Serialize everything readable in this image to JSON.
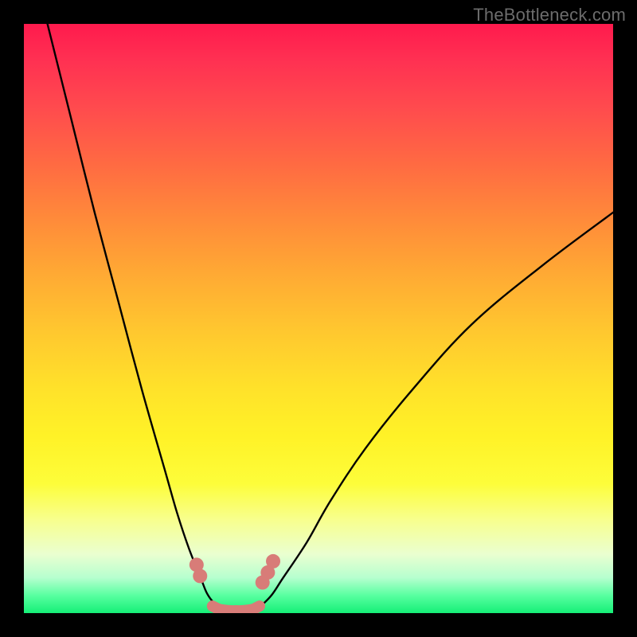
{
  "watermark": "TheBottleneck.com",
  "gradient": {
    "stops": [
      {
        "pos": 0.0,
        "color": "#ff1a4d"
      },
      {
        "pos": 0.06,
        "color": "#ff3052"
      },
      {
        "pos": 0.14,
        "color": "#ff4a4e"
      },
      {
        "pos": 0.24,
        "color": "#ff6b42"
      },
      {
        "pos": 0.33,
        "color": "#ff8a3a"
      },
      {
        "pos": 0.42,
        "color": "#ffa834"
      },
      {
        "pos": 0.52,
        "color": "#ffc72f"
      },
      {
        "pos": 0.62,
        "color": "#ffe22a"
      },
      {
        "pos": 0.7,
        "color": "#fff227"
      },
      {
        "pos": 0.78,
        "color": "#fdfd3a"
      },
      {
        "pos": 0.84,
        "color": "#f8ff8c"
      },
      {
        "pos": 0.9,
        "color": "#eaffd0"
      },
      {
        "pos": 0.94,
        "color": "#b6ffcf"
      },
      {
        "pos": 0.97,
        "color": "#58ffa0"
      },
      {
        "pos": 1.0,
        "color": "#15ef77"
      }
    ]
  },
  "chart_data": {
    "type": "line",
    "title": "",
    "xlabel": "",
    "ylabel": "",
    "xlim": [
      0,
      100
    ],
    "ylim": [
      0,
      100
    ],
    "grid": false,
    "series": [
      {
        "name": "left-branch",
        "x": [
          4,
          8,
          12,
          16,
          20,
          24,
          26,
          28,
          30,
          31,
          32,
          33
        ],
        "y": [
          100,
          84,
          68,
          53,
          38,
          24,
          17,
          11,
          6,
          3.5,
          2,
          1
        ]
      },
      {
        "name": "right-branch",
        "x": [
          40,
          42,
          44,
          48,
          52,
          58,
          66,
          76,
          88,
          100
        ],
        "y": [
          1,
          3,
          6,
          12,
          19,
          28,
          38,
          49,
          59,
          68
        ]
      },
      {
        "name": "valley-floor",
        "x": [
          32,
          33,
          34,
          35,
          36,
          37,
          38,
          39,
          40
        ],
        "y": [
          1.2,
          0.7,
          0.5,
          0.4,
          0.4,
          0.4,
          0.5,
          0.7,
          1.2
        ]
      }
    ],
    "markers": [
      {
        "name": "left-dot-1",
        "x": 29.3,
        "y": 8.2
      },
      {
        "name": "left-dot-2",
        "x": 29.9,
        "y": 6.3
      },
      {
        "name": "right-dot-1",
        "x": 40.5,
        "y": 5.2
      },
      {
        "name": "right-dot-2",
        "x": 41.4,
        "y": 6.9
      },
      {
        "name": "right-dot-3",
        "x": 42.3,
        "y": 8.8
      }
    ],
    "marker_color": "#d87c78",
    "floor_stroke_color": "#d87c78",
    "curve_stroke_color": "#000000"
  }
}
